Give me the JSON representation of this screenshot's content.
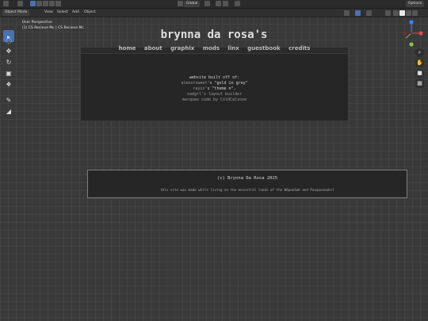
{
  "topbar": {
    "orientation": "Global",
    "options_label": "Options"
  },
  "header": {
    "mode_label": "Object Mode",
    "menu": [
      "View",
      "Select",
      "Add",
      "Object"
    ]
  },
  "viewport": {
    "perspective_label": "User Perspective",
    "object_info": "(1) CS Recieve Mc | CS Recieve Mc"
  },
  "site": {
    "title": "brynna da rosa's",
    "nav": [
      "home",
      "about",
      "graphix",
      "mods",
      "linx",
      "guestbook",
      "credits"
    ],
    "credits": {
      "heading": "website built off of:",
      "line1_name": "almostsweet",
      "line1_rest": "'s \"gold in grey\"",
      "line2_name": "rayin",
      "line2_rest": "'s \"theme n\",",
      "line3": "sadgrl's layout builder",
      "line4_pre": "marquee code by",
      "line4_name": "ColdCalzone"
    },
    "footer": {
      "copyright": "(c) Brynna Da Rosa 2025",
      "land_note": "this site was made while living on the ancestral lands of the Wôpanâak and Pauquunaukit"
    }
  },
  "colors": {
    "accent": "#4772b3",
    "viewport_bg": "#393939",
    "gizmo_x": "#e04a4a",
    "gizmo_y": "#8bc34a",
    "gizmo_z": "#3b82f6"
  }
}
